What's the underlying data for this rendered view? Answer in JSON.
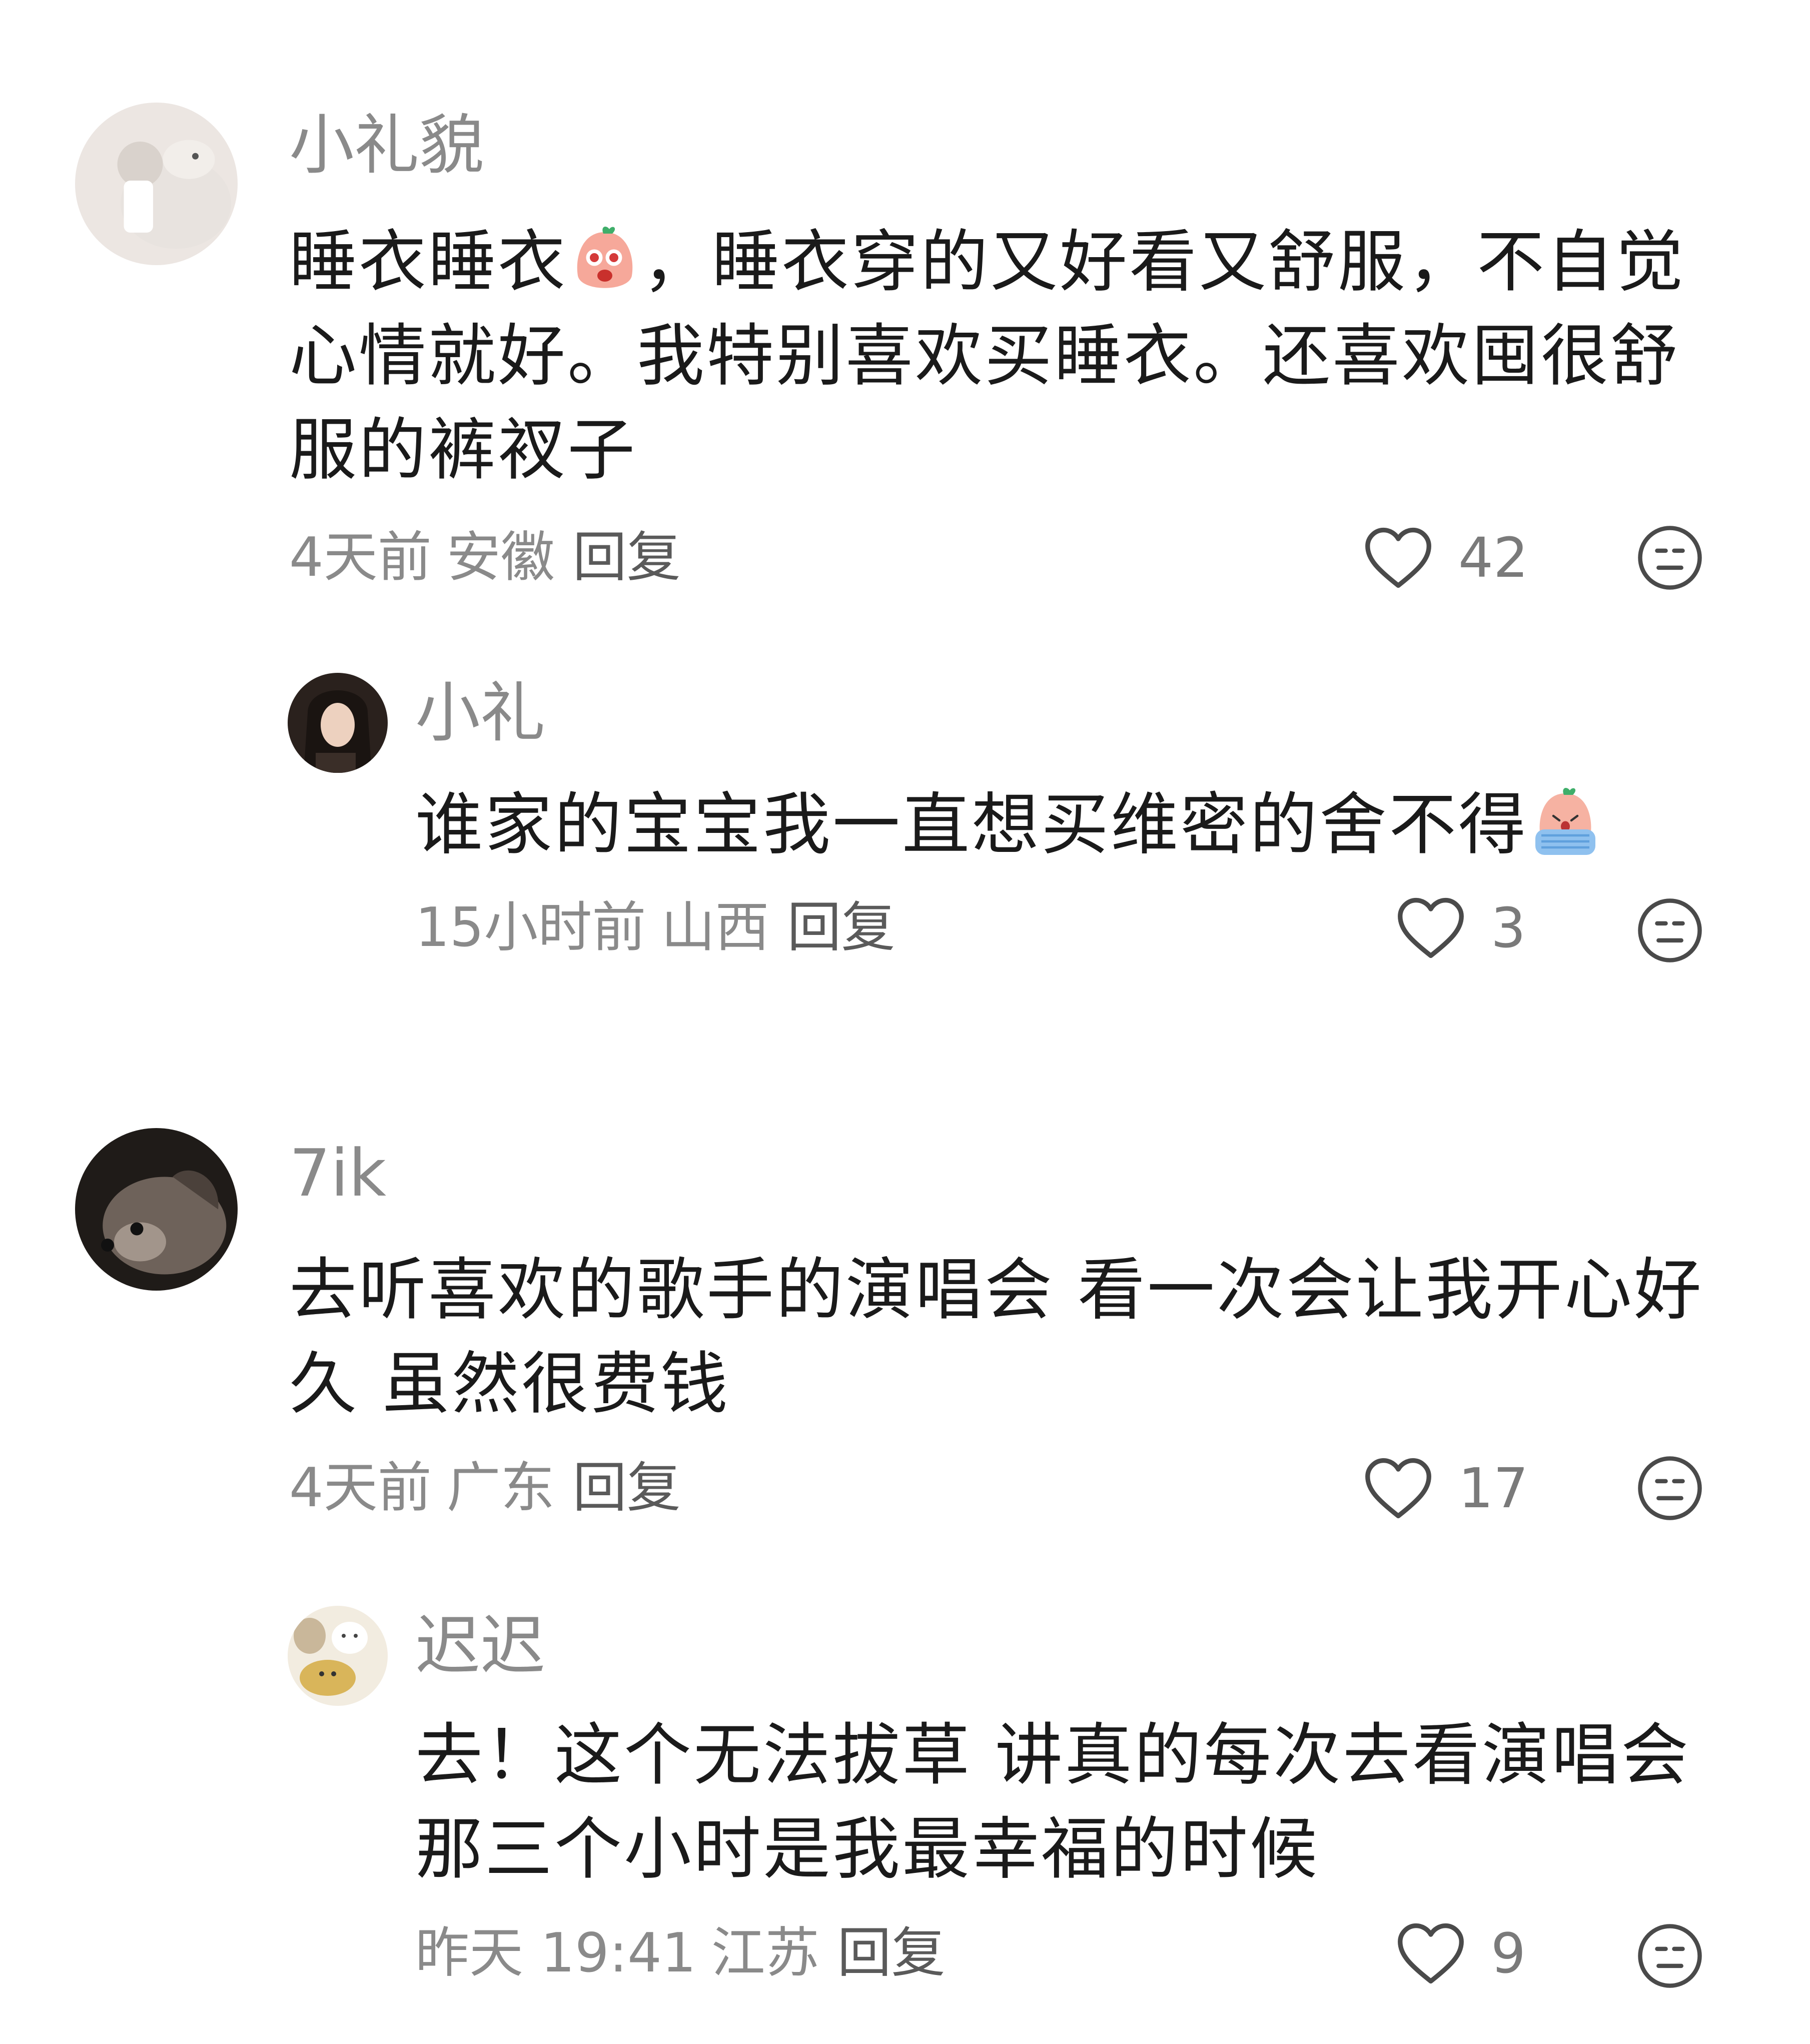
{
  "comments": [
    {
      "username": "小礼貌",
      "text_a": "睡衣睡衣",
      "text_b": "，睡衣穿的又好看又舒服，不自觉心情就好。我特别喜欢买睡衣。还喜欢囤很舒服的裤衩子",
      "emoji": "surprised-peach-emoji",
      "time": "4天前",
      "location": "安徽",
      "reply_label": "回复",
      "likes": "42",
      "replies": [
        {
          "username": "小礼",
          "text_a": "谁家的宝宝我一直想买维密的舍不得",
          "emoji": "crying-peach-emoji",
          "time": "15小时前",
          "location": "山西",
          "reply_label": "回复",
          "likes": "3"
        }
      ]
    },
    {
      "username": "7ik",
      "text_a": "去听喜欢的歌手的演唱会 看一次会让我开心好久 虽然很费钱",
      "time": "4天前",
      "location": "广东",
      "reply_label": "回复",
      "likes": "17",
      "replies": [
        {
          "username": "迟迟",
          "text_a": "去！这个无法拔草 讲真的每次去看演唱会那三个小时是我最幸福的时候",
          "time": "昨天 19:41",
          "location": "江苏",
          "reply_label": "回复",
          "likes": "9"
        }
      ]
    }
  ],
  "icons": {
    "like": "heart-outline-icon",
    "dislike": "neutral-face-icon"
  },
  "colors": {
    "text": "#1a1a1a",
    "meta": "#8a8a8a"
  }
}
